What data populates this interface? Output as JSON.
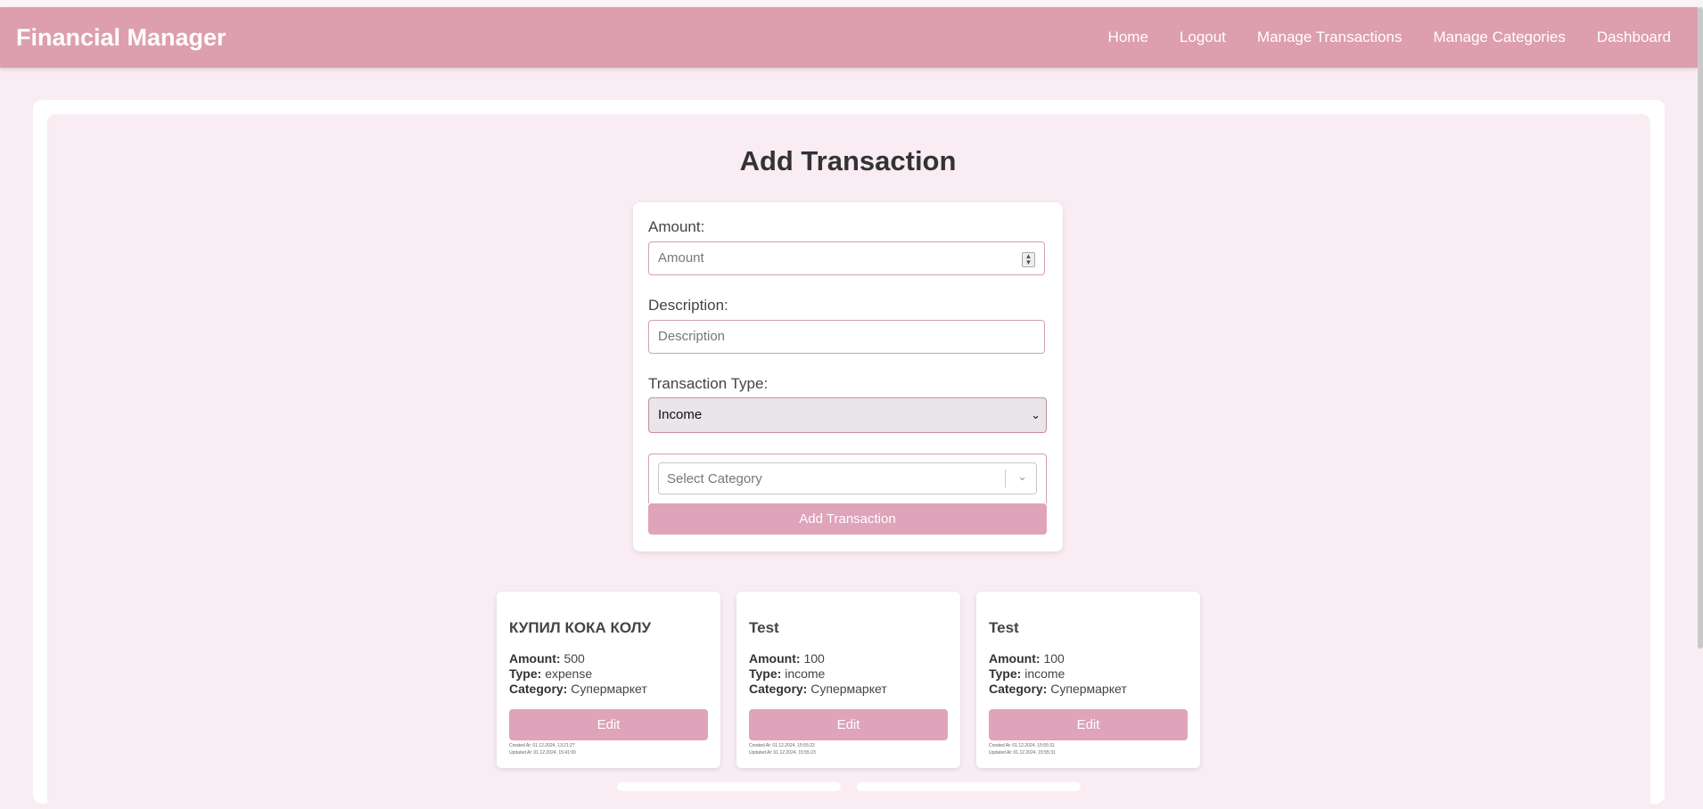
{
  "navbar": {
    "brand": "Financial Manager",
    "links": [
      "Home",
      "Logout",
      "Manage Transactions",
      "Manage Categories",
      "Dashboard"
    ]
  },
  "page_title": "Add Transaction",
  "form": {
    "amount_label": "Amount:",
    "amount_placeholder": "Amount",
    "description_label": "Description:",
    "description_placeholder": "Description",
    "type_label": "Transaction Type:",
    "type_value": "Income",
    "category_placeholder": "Select Category",
    "submit_label": "Add Transaction"
  },
  "field_labels": {
    "amount": "Amount:",
    "type": "Type:",
    "category": "Category:"
  },
  "transactions": [
    {
      "title": "КУПИЛ КОКА КОЛУ",
      "amount": "500",
      "type": "expense",
      "category": "Супермаркет",
      "edit_label": "Edit",
      "created": "Created At: 01.12.2024, 13:21:27",
      "updated": "Updated At: 01.12.2024, 15:41:00"
    },
    {
      "title": "Test",
      "amount": "100",
      "type": "income",
      "category": "Супермаркет",
      "edit_label": "Edit",
      "created": "Created At: 01.12.2024, 15:55:23",
      "updated": "Updated At: 01.12.2024, 15:55:23"
    },
    {
      "title": "Test",
      "amount": "100",
      "type": "income",
      "category": "Супермаркет",
      "edit_label": "Edit",
      "created": "Created At: 01.12.2024, 15:55:31",
      "updated": "Updated At: 01.12.2024, 15:55:31"
    }
  ],
  "colors": {
    "navbar": "#dd9eae",
    "button": "#dfa3ba",
    "background": "#f9ecf3"
  }
}
